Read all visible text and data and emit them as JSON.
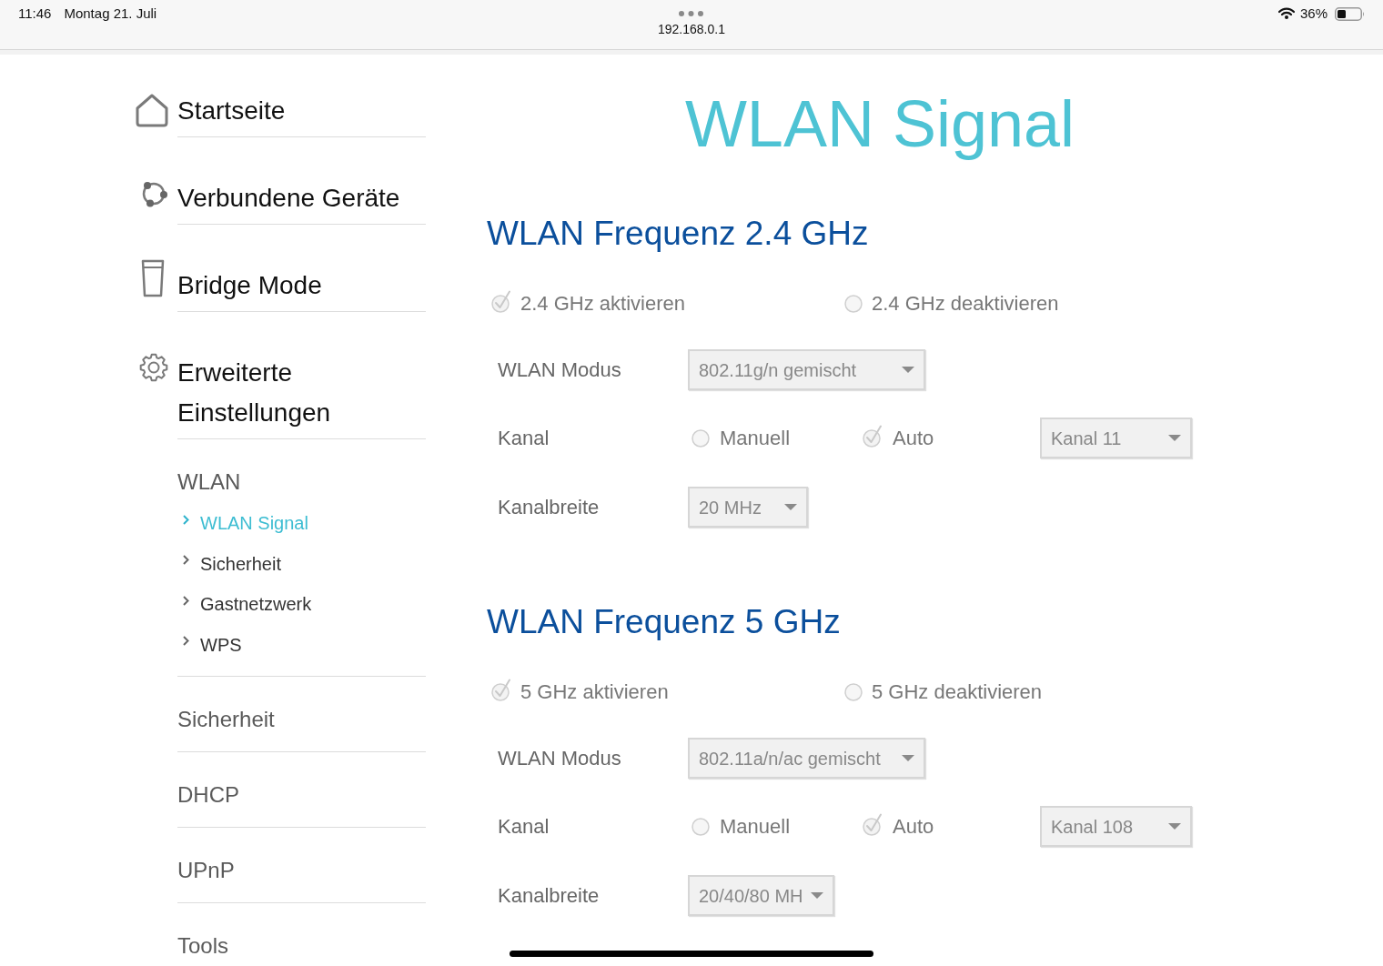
{
  "status_bar": {
    "time": "11:46",
    "date": "Montag 21. Juli",
    "url": "192.168.0.1",
    "battery": "36%"
  },
  "sidebar": {
    "items": [
      {
        "label": "Startseite",
        "selected": false
      },
      {
        "label": "Verbundene Geräte",
        "selected": false
      },
      {
        "label": "Bridge Mode",
        "selected": false
      },
      {
        "label": "Erweiterte Einstellungen",
        "selected": false,
        "children": [
          {
            "label": "WLAN",
            "selected": false,
            "children": [
              {
                "label": "WLAN Signal",
                "selected": true
              },
              {
                "label": "Sicherheit",
                "selected": false
              },
              {
                "label": "Gastnetzwerk",
                "selected": false
              },
              {
                "label": "WPS",
                "selected": false
              }
            ]
          },
          {
            "label": "Sicherheit",
            "selected": false
          },
          {
            "label": "DHCP",
            "selected": false
          },
          {
            "label": "UPnP",
            "selected": false
          },
          {
            "label": "Tools",
            "selected": false
          }
        ]
      }
    ]
  },
  "page_title": "WLAN Signal",
  "sections": [
    {
      "heading": "WLAN Frequenz 2.4 GHz",
      "enable_options": [
        {
          "label": "2.4 GHz aktivieren",
          "selected": true
        },
        {
          "label": "2.4 GHz deaktivieren",
          "selected": false
        }
      ],
      "fields": [
        {
          "label": "WLAN Modus",
          "kind": "select",
          "select": {
            "value": "802.11g/n gemischt",
            "disabled": true
          }
        },
        {
          "label": "Kanal",
          "kind": "channel",
          "options": [
            {
              "label": "Manuell",
              "selected": false
            },
            {
              "label": "Auto",
              "selected": true
            }
          ],
          "select": {
            "value": "Kanal 11",
            "disabled": true
          }
        },
        {
          "label": "Kanalbreite",
          "kind": "select",
          "select": {
            "value": "20 MHz",
            "disabled": true
          }
        }
      ]
    },
    {
      "heading": "WLAN Frequenz 5 GHz",
      "enable_options": [
        {
          "label": "5 GHz aktivieren",
          "selected": true
        },
        {
          "label": "5 GHz deaktivieren",
          "selected": false
        }
      ],
      "fields": [
        {
          "label": "WLAN Modus",
          "kind": "select",
          "select": {
            "value": "802.11a/n/ac gemischt",
            "disabled": true
          }
        },
        {
          "label": "Kanal",
          "kind": "channel",
          "options": [
            {
              "label": "Manuell",
              "selected": false
            },
            {
              "label": "Auto",
              "selected": true
            }
          ],
          "select": {
            "value": "Kanal 108",
            "disabled": true
          }
        },
        {
          "label": "Kanalbreite",
          "kind": "select",
          "select": {
            "value": "20/40/80 MH",
            "disabled": true
          }
        }
      ]
    }
  ]
}
